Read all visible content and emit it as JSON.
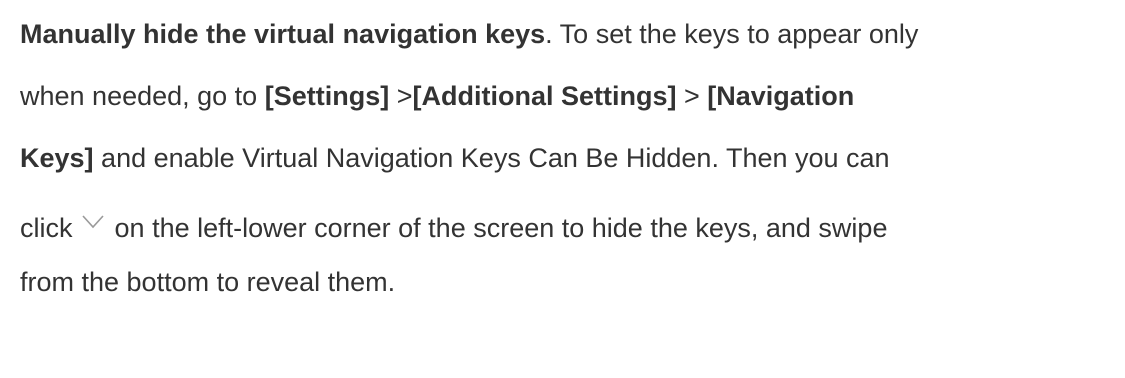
{
  "paragraph": {
    "heading": "Manually hide the virtual navigation keys",
    "line1_after": ". To set the keys to appear only",
    "line2_before": "when needed, go to ",
    "settings": "[Settings]",
    "sep1": " >",
    "additional_settings": "[Additional Settings]",
    "sep2": " > ",
    "navigation_part1": "[Navigation",
    "navigation_part2": "Keys]",
    "line4_after": " and enable Virtual Navigation Keys Can Be Hidden. Then you can",
    "line5_before": "click",
    "line5_after": "on the left-lower corner of the screen to hide the keys, and swipe",
    "line6": "from the bottom to reveal them.",
    "chevron_icon": "chevron-down-icon",
    "chevron_color": "#9a9a9a"
  }
}
